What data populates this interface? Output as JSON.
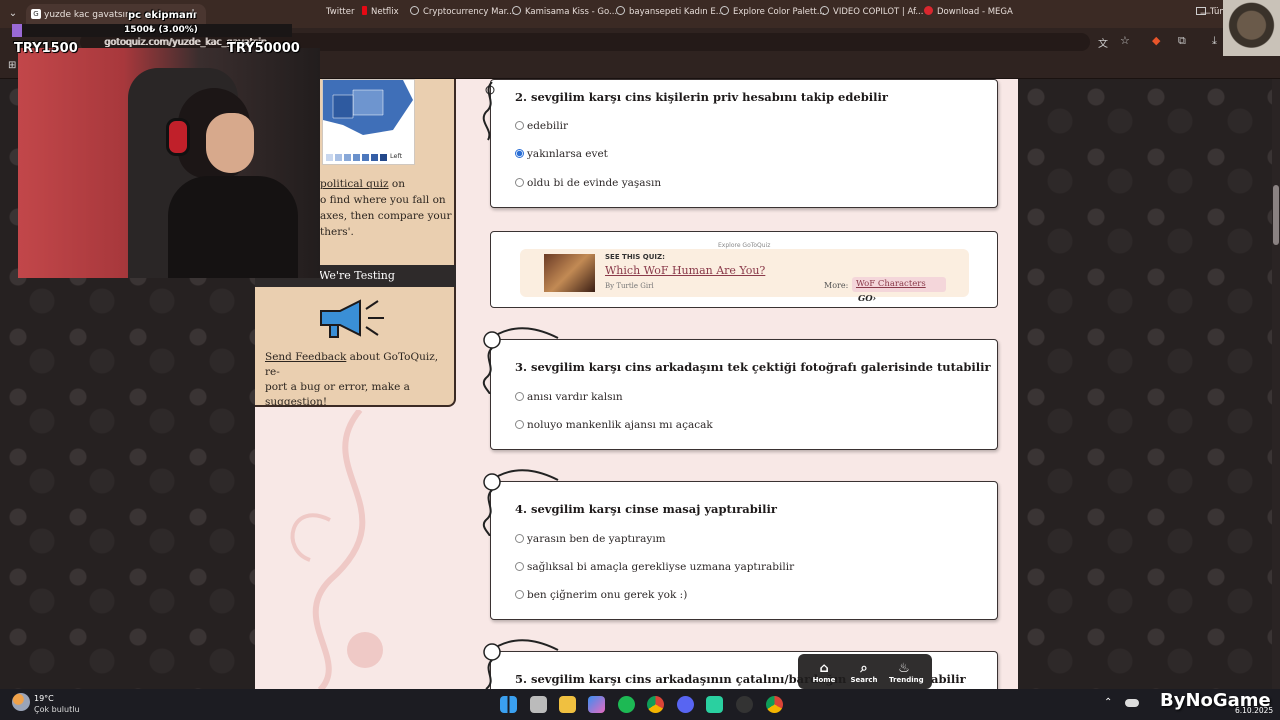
{
  "stream": {
    "title": "pc ekipmanı",
    "donation": "1500₺ (3.00%)",
    "goal_left": "TRY1500",
    "goal_right": "TRY50000"
  },
  "browser": {
    "tab_title": "yuzde kac gavatsın",
    "url": "gotoquiz.com/yuzde_kac_gavatsin",
    "bookmarks": [
      {
        "label": "Twitter",
        "color": "#1d9bf0"
      },
      {
        "label": "Netflix",
        "color": "#e50914"
      },
      {
        "label": "Cryptocurrency Mar...",
        "color": "#c8c8c8"
      },
      {
        "label": "Kamisama Kiss - Go...",
        "color": "#c8c8c8"
      },
      {
        "label": "bayansepeti Kadın E...",
        "color": "#c8c8c8"
      },
      {
        "label": "Explore Color Palett...",
        "color": "#c8c8c8"
      },
      {
        "label": "VIDEO COPILOT | Af...",
        "color": "#c8c8c8"
      },
      {
        "label": "Download - MEGA",
        "color": "#d9272e"
      }
    ],
    "all_bookmarks": "Tüm Yer İşaretleri"
  },
  "sidebar": {
    "map_legend_label": "Left",
    "quiz_text_pre": "political quiz",
    "quiz_text_post": " on",
    "line2": "o find where you fall on",
    "line3": " axes, then compare your",
    "line4": "thers'.",
    "testing_title": "We're Testing",
    "feedback_link": "Send Feedback",
    "feedback_rest": " about GoToQuiz, re-",
    "feedback_line2": "port a bug or error, make a",
    "feedback_line3": "suggestion!"
  },
  "questions": [
    {
      "text": "2. sevgilim karşı cins kişilerin priv hesabını takip edebilir",
      "options": [
        "edebilir",
        "yakınlarsa evet",
        "oldu bi de evinde yaşasın"
      ],
      "selected": 1
    },
    {
      "text": "3. sevgilim karşı cins arkadaşını tek çektiği fotoğrafı galerisinde tutabilir",
      "options": [
        "anısı vardır kalsın",
        "noluyo mankenlik ajansı mı açacak"
      ]
    },
    {
      "text": "4. sevgilim karşı cinse masaj yaptırabilir",
      "options": [
        "yarasın ben de yaptırayım",
        "sağlıksal bi amaçla gerekliyse uzmana yaptırabilir",
        "ben çiğnerim onu gerek yok :)"
      ]
    },
    {
      "text": "5. sevgilim karşı cins arkadaşının çatalını/bardağın",
      "text_tail": "abilir"
    }
  ],
  "promo": {
    "badge": "Explore GoToQuiz",
    "see": "SEE THIS QUIZ:",
    "title": "Which WoF Human Are You?",
    "by": "By Turtle Girl",
    "more": "More:",
    "more_link": "WoF Characters",
    "go": "GO›"
  },
  "nav": {
    "home": "Home",
    "search": "Search",
    "trending": "Trending"
  },
  "taskbar": {
    "temp": "19°C",
    "weather": "Çok bulutlu",
    "date": "6.10.2025",
    "watermark": "ByNoGame"
  }
}
